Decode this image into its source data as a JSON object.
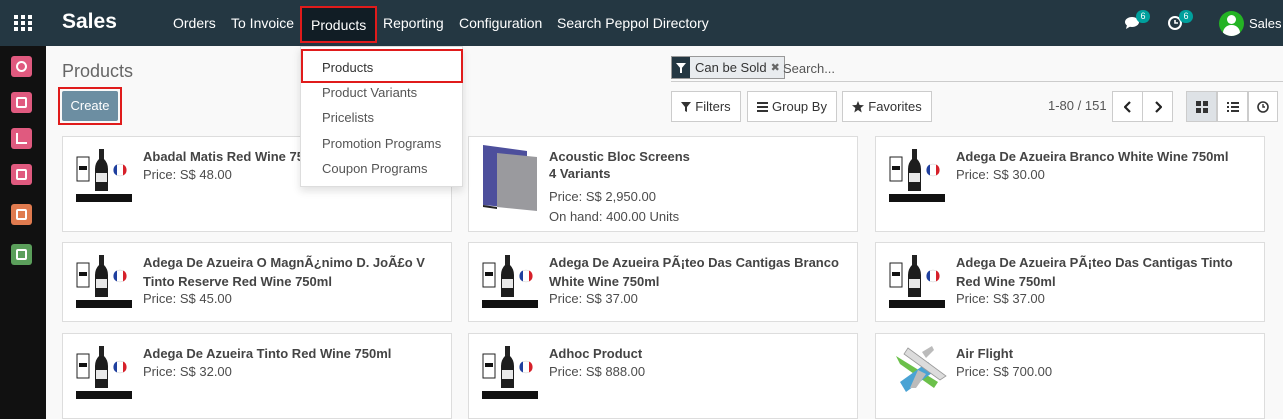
{
  "topbar": {
    "app_name": "Sales",
    "menu": [
      "Orders",
      "To Invoice",
      "Products",
      "Reporting",
      "Configuration",
      "Search Peppol Directory"
    ],
    "active_menu": "Products",
    "messages_count": "6",
    "activities_count": "6",
    "user_name": "Sales"
  },
  "products_menu": {
    "items": [
      "Products",
      "Product Variants",
      "Pricelists",
      "Promotion Programs",
      "Coupon Programs"
    ]
  },
  "control_panel": {
    "breadcrumb": "Products",
    "create_label": "Create",
    "facet_value": "Can be Sold",
    "facet_remove": "✖",
    "search_placeholder": "Search...",
    "filters_label": "Filters",
    "group_by_label": "Group By",
    "favorites_label": "Favorites",
    "pager_value": "1-80 / 151"
  },
  "colors": {
    "navbar": "#243742",
    "rail": "#111111",
    "accent": "#6c8ea2",
    "highlight_border": "#e01b1b",
    "badge": "#00a09d"
  },
  "rail_apps": [
    {
      "icon": "discuss-icon",
      "color": "#e05a7f"
    },
    {
      "icon": "contacts-icon",
      "color": "#e05a7f"
    },
    {
      "icon": "sales-icon",
      "color": "#e05a7f"
    },
    {
      "icon": "inventory-icon",
      "color": "#e05a7f"
    },
    {
      "icon": "invoicing-icon",
      "color": "#e07b4f"
    },
    {
      "icon": "documents-icon",
      "color": "#5b9f5b"
    }
  ],
  "products": [
    {
      "name": "Abadal Matis Red Wine 750ml",
      "lines": [
        "Price: S$ 48.00"
      ],
      "image": "wine-bottle-icon"
    },
    {
      "name": "Acoustic Bloc Screens",
      "lines": [
        "4 Variants",
        "Price: S$ 2,950.00",
        "On hand: 400.00 Units"
      ],
      "image": "acoustic-screen-icon"
    },
    {
      "name": "Adega De Azueira Branco White Wine 750ml",
      "lines": [
        "Price: S$ 30.00"
      ],
      "image": "wine-bottle-icon"
    },
    {
      "name": "Adega De Azueira O MagnÃ¿nimo D. JoÃ£o V Tinto Reserve Red Wine 750ml",
      "lines": [
        "Price: S$ 45.00"
      ],
      "image": "wine-bottle-icon"
    },
    {
      "name": "Adega De Azueira PÃ¡teo Das Cantigas Branco White Wine 750ml",
      "lines": [
        "Price: S$ 37.00"
      ],
      "image": "wine-bottle-icon"
    },
    {
      "name": "Adega De Azueira PÃ¡teo Das Cantigas Tinto Red Wine 750ml",
      "lines": [
        "Price: S$ 37.00"
      ],
      "image": "wine-bottle-icon"
    },
    {
      "name": "Adega De Azueira Tinto Red Wine 750ml",
      "lines": [
        "Price: S$ 32.00"
      ],
      "image": "wine-bottle-icon"
    },
    {
      "name": "Adhoc Product",
      "lines": [
        "Price: S$ 888.00"
      ],
      "image": "wine-bottle-icon"
    },
    {
      "name": "Air Flight",
      "lines": [
        "Price: S$ 700.00"
      ],
      "image": "airplane-icon"
    }
  ]
}
